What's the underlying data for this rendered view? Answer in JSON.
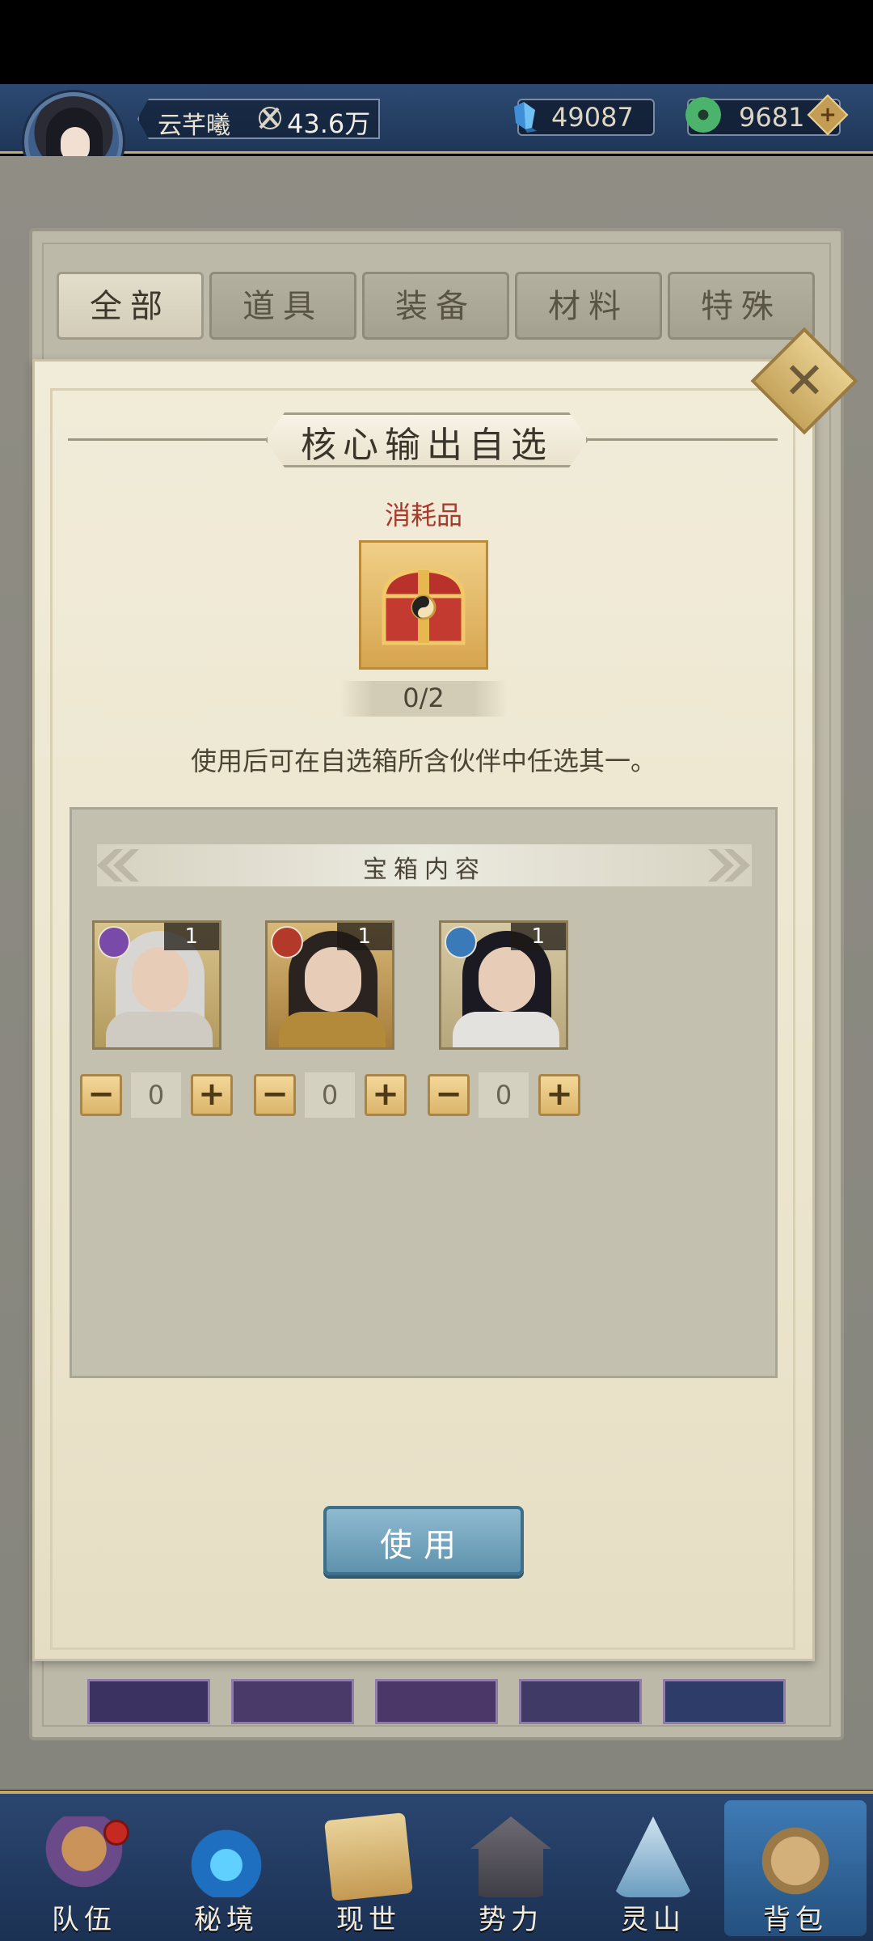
{
  "header": {
    "player_name": "云芊曦",
    "power": "43.6万",
    "currency_gem": "49087",
    "currency_jade": "9681",
    "plus_label": "+"
  },
  "tabs": [
    {
      "label": "全部",
      "active": true
    },
    {
      "label": "道具",
      "active": false
    },
    {
      "label": "装备",
      "active": false
    },
    {
      "label": "材料",
      "active": false
    },
    {
      "label": "特殊",
      "active": false
    }
  ],
  "modal": {
    "close_label": "✕",
    "title": "核心输出自选",
    "category": "消耗品",
    "count": "0/2",
    "description": "使用后可在自选箱所含伙伴中任选其一。",
    "content_title": "宝箱内容",
    "heroes": [
      {
        "level": "1",
        "element": "purple-swirl",
        "qty": "0"
      },
      {
        "level": "1",
        "element": "fire",
        "qty": "0"
      },
      {
        "level": "1",
        "element": "water",
        "qty": "0"
      }
    ],
    "minus_label": "−",
    "plus_label": "+",
    "use_button": "使用"
  },
  "bottom_nav": [
    {
      "label": "队伍",
      "icon": "team-icon",
      "active": false
    },
    {
      "label": "秘境",
      "icon": "secret-realm-icon",
      "active": false
    },
    {
      "label": "现世",
      "icon": "world-scroll-icon",
      "active": false
    },
    {
      "label": "势力",
      "icon": "faction-temple-icon",
      "active": false
    },
    {
      "label": "灵山",
      "icon": "spirit-mountain-icon",
      "active": false
    },
    {
      "label": "背包",
      "icon": "bag-icon",
      "active": true
    }
  ],
  "colors": {
    "accent_gold": "#c9a86a",
    "header_blue": "#2d4a72",
    "title_red": "#a63a2c",
    "use_button_blue": "#5e92ad"
  }
}
